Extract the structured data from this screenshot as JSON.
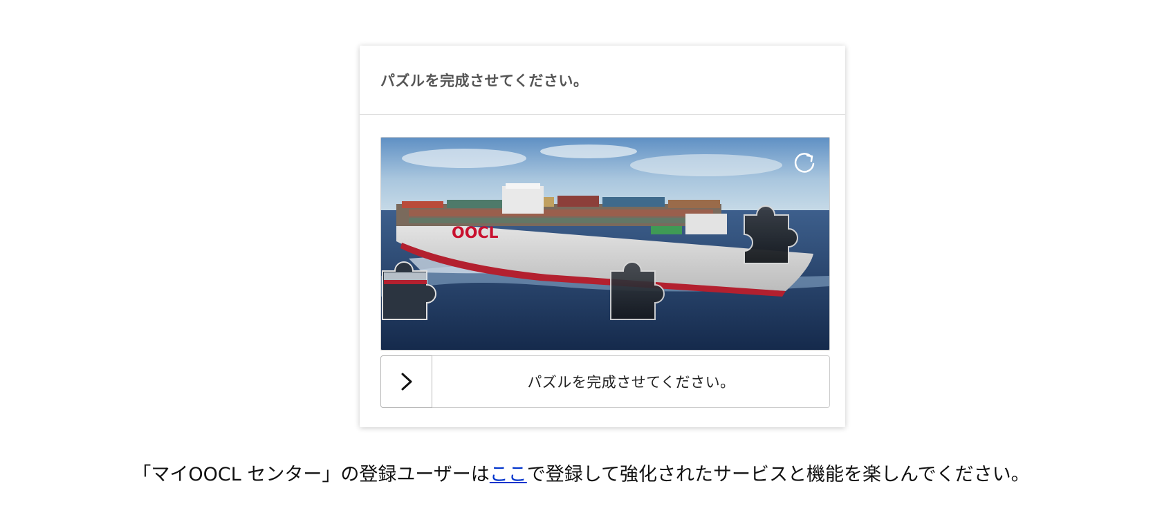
{
  "captcha": {
    "title": "パズルを完成させてください。",
    "image_brand_text": "OOCL",
    "refresh_icon": "refresh-icon",
    "slider_icon": "chevron-right-icon",
    "slider_label": "パズルを完成させてください。"
  },
  "footer": {
    "text_before": "「マイOOCL センター」の登録ユーザーは",
    "link_text": "ここ",
    "text_after": "で登録して強化されたサービスと機能を楽しんでください。"
  },
  "colors": {
    "link": "#0033cc",
    "title": "#555555",
    "brand": "#c8102e"
  }
}
